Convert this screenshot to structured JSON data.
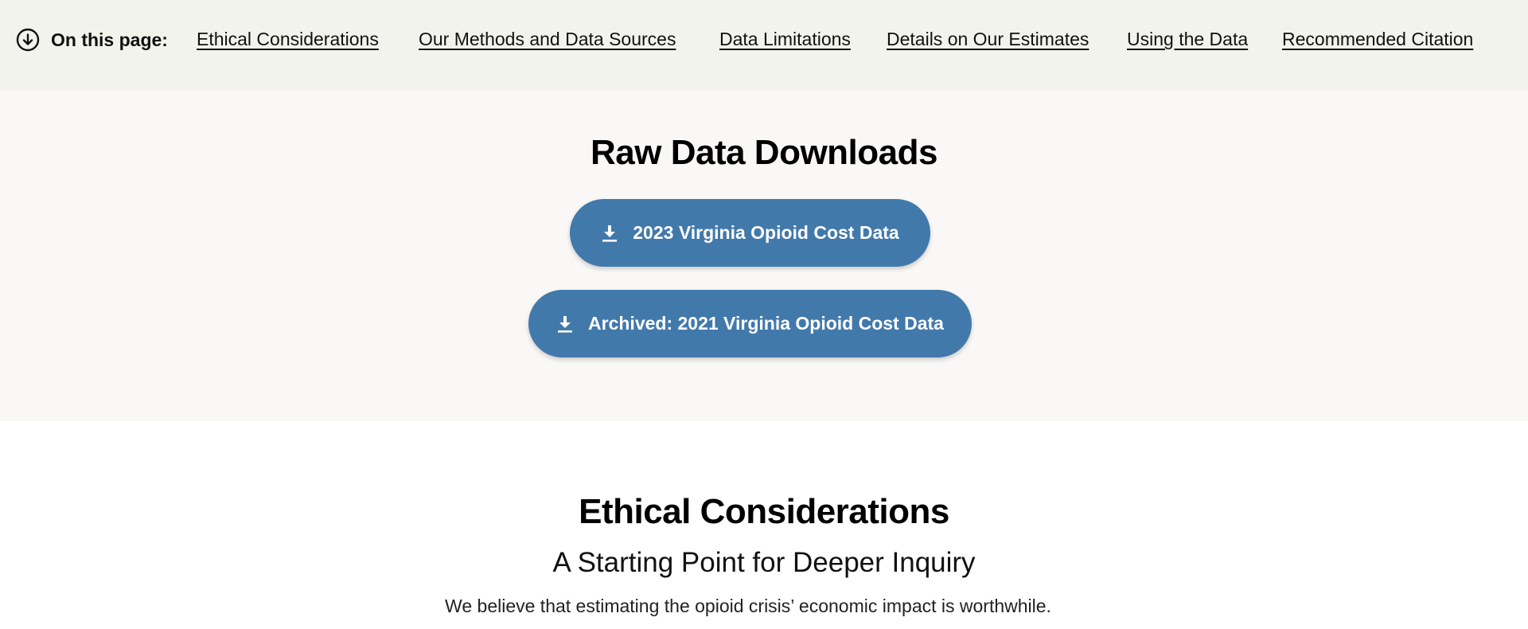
{
  "page_nav": {
    "heading": "On this page:",
    "icon": "arrow-down-circle-icon",
    "links": [
      {
        "label": "Ethical Considerations"
      },
      {
        "label": "Our Methods and Data Sources"
      },
      {
        "label": "Data Limitations"
      },
      {
        "label": "Details on Our Estimates"
      },
      {
        "label": "Using the Data"
      },
      {
        "label": "Recommended Citation"
      }
    ]
  },
  "downloads": {
    "title": "Raw Data Downloads",
    "buttons": [
      {
        "label": "2023 Virginia Opioid Cost Data",
        "icon": "download-icon"
      },
      {
        "label": "Archived: 2021 Virginia Opioid Cost Data",
        "icon": "download-icon"
      }
    ]
  },
  "ethics": {
    "title": "Ethical Considerations",
    "subtitle": "A Starting Point for Deeper Inquiry",
    "body": "We believe that estimating the opioid crisis’ economic impact is worthwhile."
  },
  "colors": {
    "nav_background": "#f3f3ee",
    "downloads_background": "#f9f8f6",
    "button_blue": "#4279ab",
    "text": "#111111"
  }
}
